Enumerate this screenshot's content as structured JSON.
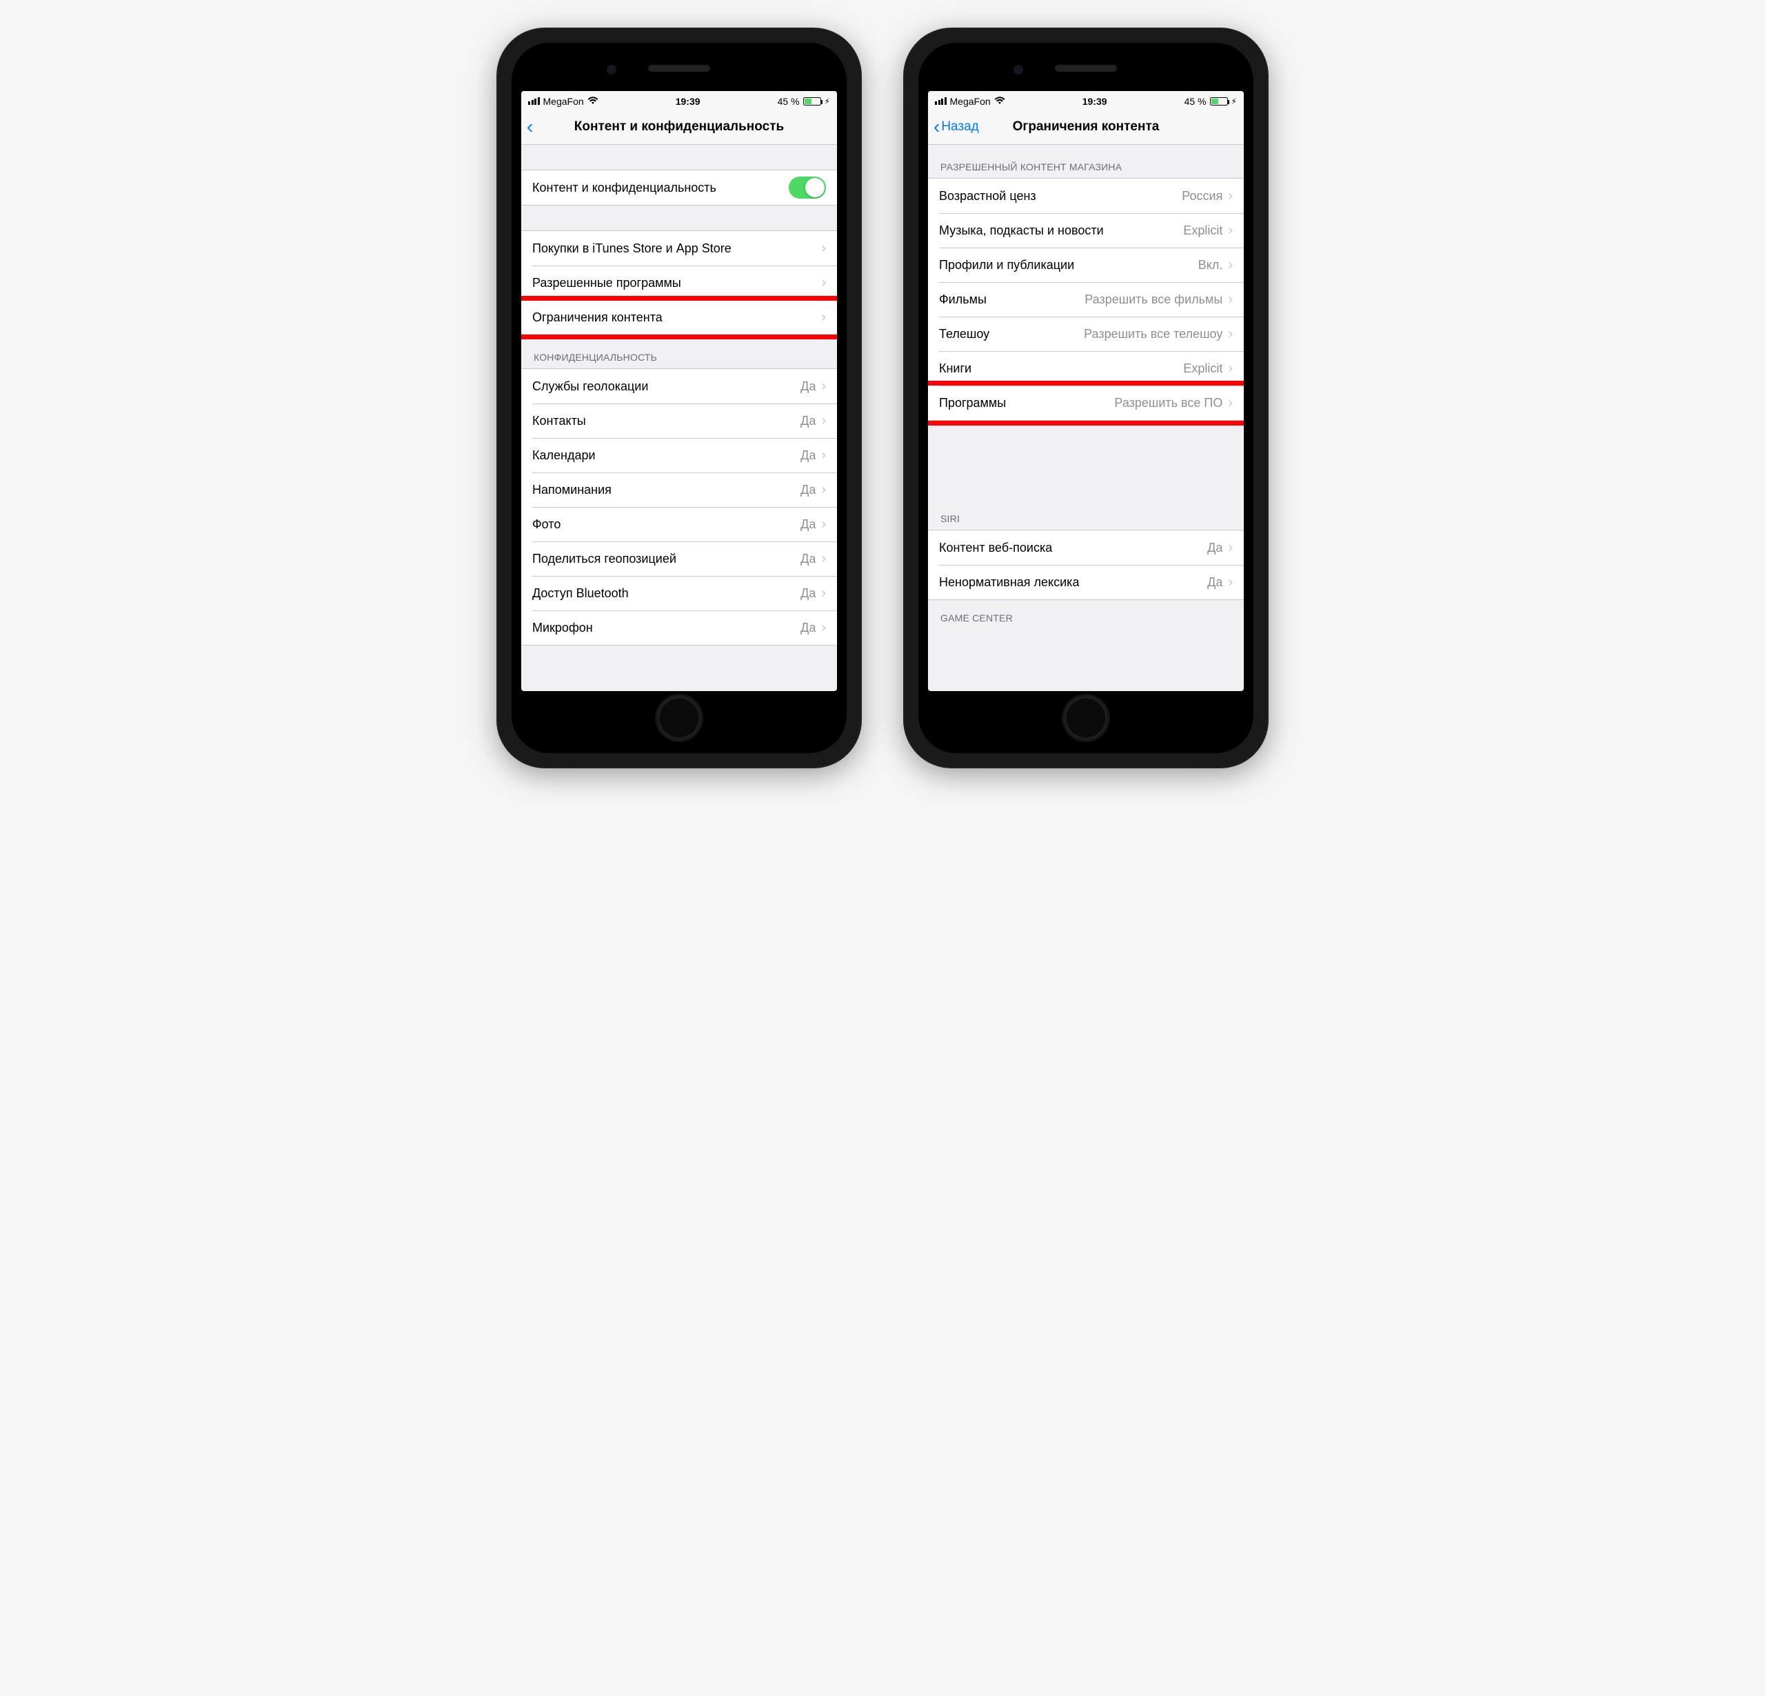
{
  "status": {
    "carrier": "MegaFon",
    "time": "19:39",
    "battery_pct": "45 %"
  },
  "left": {
    "nav_title": "Контент и конфиденциальность",
    "toggle_row": {
      "label": "Контент и конфиденциальность"
    },
    "group1": [
      {
        "label": "Покупки в iTunes Store и App Store"
      },
      {
        "label": "Разрешенные программы"
      },
      {
        "label": "Ограничения контента"
      }
    ],
    "privacy_header": "КОНФИДЕНЦИАЛЬНОСТЬ",
    "privacy_rows": [
      {
        "label": "Службы геолокации",
        "value": "Да"
      },
      {
        "label": "Контакты",
        "value": "Да"
      },
      {
        "label": "Календари",
        "value": "Да"
      },
      {
        "label": "Напоминания",
        "value": "Да"
      },
      {
        "label": "Фото",
        "value": "Да"
      },
      {
        "label": "Поделиться геопозицией",
        "value": "Да"
      },
      {
        "label": "Доступ Bluetooth",
        "value": "Да"
      },
      {
        "label": "Микрофон",
        "value": "Да"
      }
    ]
  },
  "right": {
    "back_label": "Назад",
    "nav_title": "Ограничения контента",
    "store_header": "РАЗРЕШЕННЫЙ КОНТЕНТ МАГАЗИНА",
    "store_rows": [
      {
        "label": "Возрастной ценз",
        "value": "Россия"
      },
      {
        "label": "Музыка, подкасты и новости",
        "value": "Explicit"
      },
      {
        "label": "Профили и публикации",
        "value": "Вкл."
      },
      {
        "label": "Фильмы",
        "value": "Разрешить все фильмы"
      },
      {
        "label": "Телешоу",
        "value": "Разрешить все телешоу"
      },
      {
        "label": "Книги",
        "value": "Explicit"
      },
      {
        "label": "Программы",
        "value": "Разрешить все ПО"
      }
    ],
    "siri_header": "SIRI",
    "siri_rows": [
      {
        "label": "Контент веб-поиска",
        "value": "Да"
      },
      {
        "label": "Ненормативная лексика",
        "value": "Да"
      }
    ],
    "gc_header": "GAME CENTER"
  }
}
